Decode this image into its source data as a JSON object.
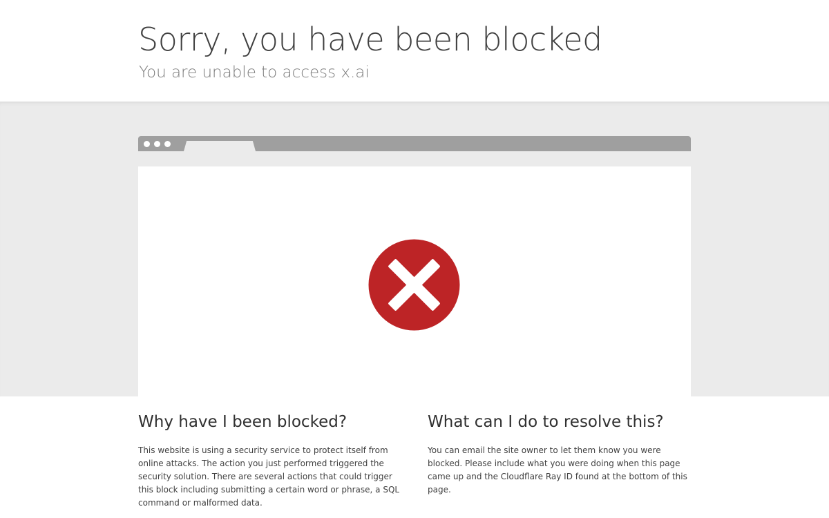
{
  "header": {
    "title": "Sorry, you have been blocked",
    "subtitle": "You are unable to access x.ai"
  },
  "icons": {
    "error": "error-x-icon",
    "error_color": "#bd2426"
  },
  "sections": [
    {
      "heading": "Why have I been blocked?",
      "body": "This website is using a security service to protect itself from online attacks. The action you just performed triggered the security solution. There are several actions that could trigger this block including submitting a certain word or phrase, a SQL command or malformed data."
    },
    {
      "heading": "What can I do to resolve this?",
      "body": "You can email the site owner to let them know you were blocked. Please include what you were doing when this page came up and the Cloudflare Ray ID found at the bottom of this page."
    }
  ]
}
